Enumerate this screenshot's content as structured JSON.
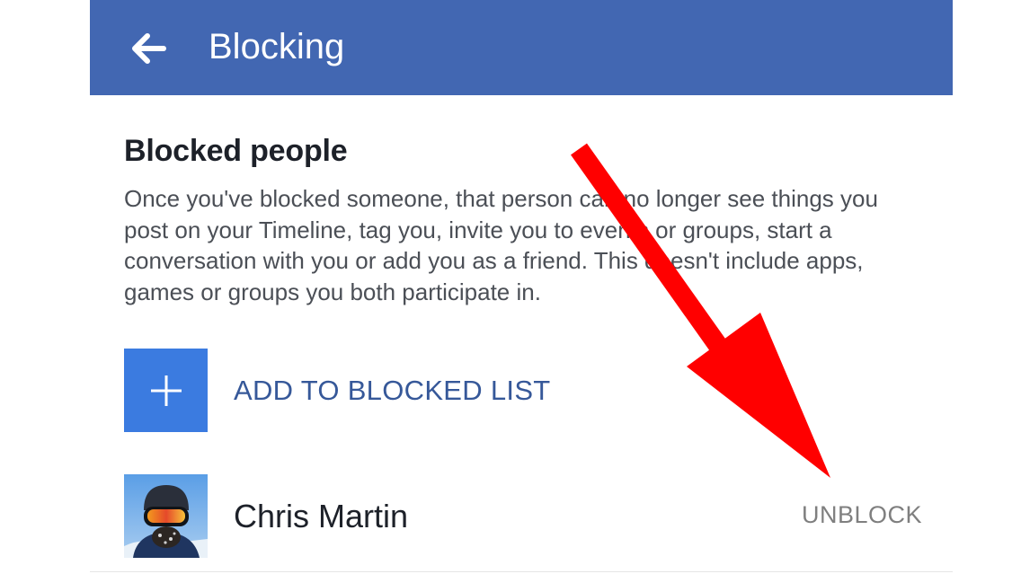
{
  "appbar": {
    "title": "Blocking",
    "back_icon": "arrow-left-icon",
    "color": "#4267b2"
  },
  "blocked_section": {
    "title": "Blocked people",
    "description": "Once you've blocked someone, that person can no longer see things you post on your Timeline, tag you, invite you to events or groups, start a conversation with you or add you as a friend. This doesn't include apps, games or groups you both participate in."
  },
  "add_button": {
    "label": "ADD TO BLOCKED LIST",
    "icon": "plus-icon",
    "tile_color": "#3b7be0",
    "label_color": "#365899"
  },
  "blocked_list": [
    {
      "name": "Chris Martin",
      "action": "UNBLOCK"
    }
  ],
  "annotation": {
    "arrow_color": "#ff0000"
  }
}
